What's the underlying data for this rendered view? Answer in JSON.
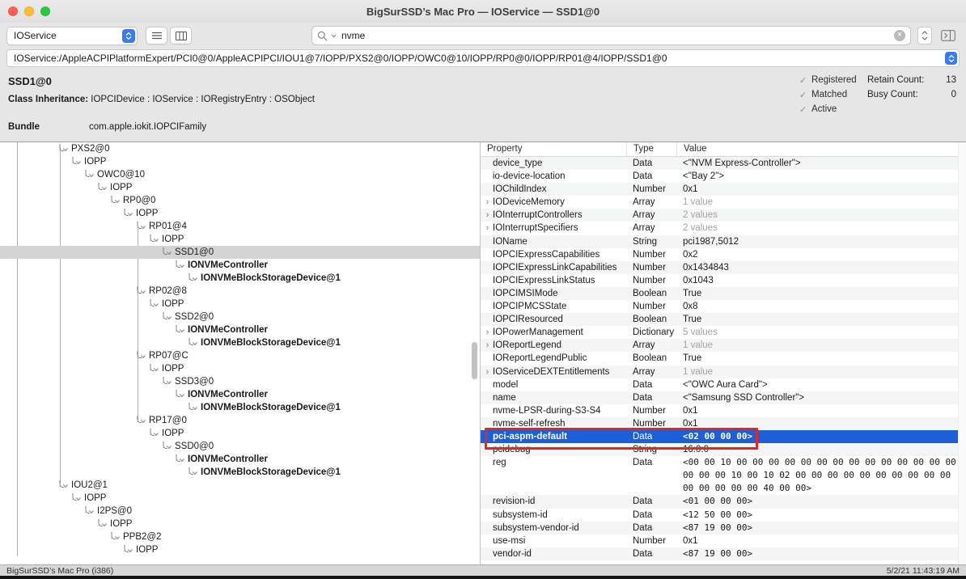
{
  "window": {
    "title": "BigSurSSD’s Mac Pro — IOService — SSD1@0"
  },
  "toolbar": {
    "plane_selector": "IOService",
    "search": {
      "value": "nvme"
    }
  },
  "path_bar": {
    "path": "IOService:/AppleACPIPlatformExpert/PCI0@0/AppleACPIPCI/IOU1@7/IOPP/PXS2@0/IOPP/OWC0@10/IOPP/RP0@0/IOPP/RP01@4/IOPP/SSD1@0"
  },
  "inspector": {
    "title": "SSD1@0",
    "class_inheritance_label": "Class Inheritance:",
    "class_inheritance": "IOPCIDevice : IOService : IORegistryEntry : OSObject",
    "bundle_label": "Bundle",
    "bundle_value": "com.apple.iokit.IOPCIFamily",
    "flags": [
      {
        "label": "Registered",
        "checked": true
      },
      {
        "label": "Matched",
        "checked": true
      },
      {
        "label": "Active",
        "checked": true
      }
    ],
    "retain_count_label": "Retain Count:",
    "retain_count_value": "13",
    "busy_count_label": "Busy Count:",
    "busy_count_value": "0"
  },
  "tree": {
    "items": [
      {
        "label": "PXS2@0",
        "depth": 3
      },
      {
        "label": "IOPP",
        "depth": 4
      },
      {
        "label": "OWC0@10",
        "depth": 5
      },
      {
        "label": "IOPP",
        "depth": 6
      },
      {
        "label": "RP0@0",
        "depth": 7
      },
      {
        "label": "IOPP",
        "depth": 8
      },
      {
        "label": "RP01@4",
        "depth": 9
      },
      {
        "label": "IOPP",
        "depth": 10
      },
      {
        "label": "SSD1@0",
        "depth": 11,
        "selected": true
      },
      {
        "label": "IONVMeController",
        "depth": 12,
        "bold": true
      },
      {
        "label": "IONVMeBlockStorageDevice@1",
        "depth": 13,
        "bold": true
      },
      {
        "label": "RP02@8",
        "depth": 9
      },
      {
        "label": "IOPP",
        "depth": 10
      },
      {
        "label": "SSD2@0",
        "depth": 11
      },
      {
        "label": "IONVMeController",
        "depth": 12,
        "bold": true
      },
      {
        "label": "IONVMeBlockStorageDevice@1",
        "depth": 13,
        "bold": true
      },
      {
        "label": "RP07@C",
        "depth": 9
      },
      {
        "label": "IOPP",
        "depth": 10
      },
      {
        "label": "SSD3@0",
        "depth": 11
      },
      {
        "label": "IONVMeController",
        "depth": 12,
        "bold": true
      },
      {
        "label": "IONVMeBlockStorageDevice@1",
        "depth": 13,
        "bold": true
      },
      {
        "label": "RP17@0",
        "depth": 9
      },
      {
        "label": "IOPP",
        "depth": 10
      },
      {
        "label": "SSD0@0",
        "depth": 11
      },
      {
        "label": "IONVMeController",
        "depth": 12,
        "bold": true
      },
      {
        "label": "IONVMeBlockStorageDevice@1",
        "depth": 13,
        "bold": true
      },
      {
        "label": "IOU2@1",
        "depth": 3
      },
      {
        "label": "IOPP",
        "depth": 4
      },
      {
        "label": "I2PS@0",
        "depth": 5
      },
      {
        "label": "IOPP",
        "depth": 6
      },
      {
        "label": "PPB2@2",
        "depth": 7
      },
      {
        "label": "IOPP",
        "depth": 8
      }
    ]
  },
  "table": {
    "headers": [
      "Property",
      "Type",
      "Value"
    ],
    "rows": [
      {
        "property": "device_type",
        "type": "Data",
        "value": "<\"NVM Express-Controller\">"
      },
      {
        "property": "io-device-location",
        "type": "Data",
        "value": "<\"Bay 2\">"
      },
      {
        "property": "IOChildIndex",
        "type": "Number",
        "value": "0x1"
      },
      {
        "property": "IODeviceMemory",
        "type": "Array",
        "value": "1 value",
        "muted": true,
        "expandable": true
      },
      {
        "property": "IOInterruptControllers",
        "type": "Array",
        "value": "2 values",
        "muted": true,
        "expandable": true
      },
      {
        "property": "IOInterruptSpecifiers",
        "type": "Array",
        "value": "2 values",
        "muted": true,
        "expandable": true
      },
      {
        "property": "IOName",
        "type": "String",
        "value": "pci1987,5012"
      },
      {
        "property": "IOPCIExpressCapabilities",
        "type": "Number",
        "value": "0x2"
      },
      {
        "property": "IOPCIExpressLinkCapabilities",
        "type": "Number",
        "value": "0x1434843"
      },
      {
        "property": "IOPCIExpressLinkStatus",
        "type": "Number",
        "value": "0x1043"
      },
      {
        "property": "IOPCIMSIMode",
        "type": "Boolean",
        "value": "True"
      },
      {
        "property": "IOPCIPMCSState",
        "type": "Number",
        "value": "0x8"
      },
      {
        "property": "IOPCIResourced",
        "type": "Boolean",
        "value": "True"
      },
      {
        "property": "IOPowerManagement",
        "type": "Dictionary",
        "value": "5 values",
        "muted": true,
        "expandable": true
      },
      {
        "property": "IOReportLegend",
        "type": "Array",
        "value": "1 value",
        "muted": true,
        "expandable": true
      },
      {
        "property": "IOReportLegendPublic",
        "type": "Boolean",
        "value": "True"
      },
      {
        "property": "IOServiceDEXTEntitlements",
        "type": "Array",
        "value": "1 value",
        "muted": true,
        "expandable": true
      },
      {
        "property": "model",
        "type": "Data",
        "value": "<\"OWC Aura Card\">"
      },
      {
        "property": "name",
        "type": "Data",
        "value": "<\"Samsung SSD Controller\">"
      },
      {
        "property": "nvme-LPSR-during-S3-S4",
        "type": "Number",
        "value": "0x1"
      },
      {
        "property": "nvme-self-refresh",
        "type": "Number",
        "value": "0x1"
      },
      {
        "property": "pci-aspm-default",
        "type": "Data",
        "value": "<02 00 00 00>",
        "mono": true,
        "selected": true,
        "annotated": true
      },
      {
        "property": "pcidebug",
        "type": "String",
        "value": "16:0:0"
      },
      {
        "property": "reg",
        "type": "Data",
        "value": "<00 00 10 00 00 00 00 00 00 00 00 00 00 00 00 00 00 00 00 00 10 00 10 02 00 00 00 00 00 00 00 00 00 00 00 00 00 00 00 40 00 00>",
        "mono": true
      },
      {
        "property": "revision-id",
        "type": "Data",
        "value": "<01 00 00 00>",
        "mono": true
      },
      {
        "property": "subsystem-id",
        "type": "Data",
        "value": "<12 50 00 00>",
        "mono": true
      },
      {
        "property": "subsystem-vendor-id",
        "type": "Data",
        "value": "<87 19 00 00>",
        "mono": true
      },
      {
        "property": "use-msi",
        "type": "Number",
        "value": "0x1"
      },
      {
        "property": "vendor-id",
        "type": "Data",
        "value": "<87 19 00 00>",
        "mono": true
      }
    ]
  },
  "status_bar": {
    "left": "BigSurSSD’s Mac Pro (i386)",
    "right": "5/2/21 11:43:19 AM"
  },
  "icons": {
    "checkmark-icon": "✓",
    "clear-icon": "×",
    "disclosure-chevron-icon": "›"
  },
  "colors": {
    "selection_blue": "#1b5fd9",
    "annotation_red": "#e8251c",
    "tree_selection_gray": "#d4d4d4",
    "accent_blue": "#3b7af7",
    "traffic_red": "#ff5f57",
    "traffic_yellow": "#febc2e",
    "traffic_green": "#28c840"
  }
}
